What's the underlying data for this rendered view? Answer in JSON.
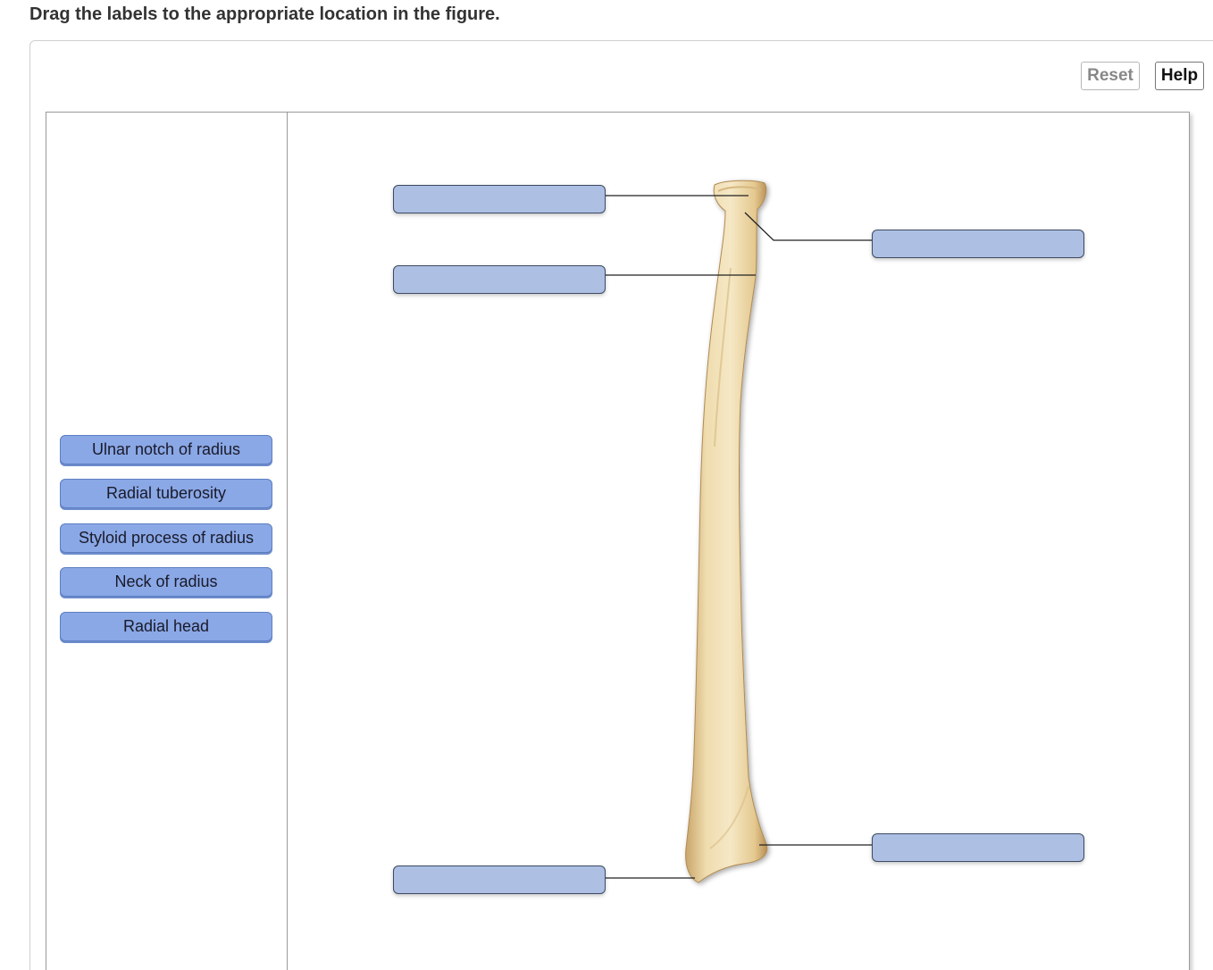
{
  "instruction": "Drag the labels to the appropriate location in the figure.",
  "toolbar": {
    "reset_label": "Reset",
    "help_label": "Help"
  },
  "label_bank": [
    {
      "label": "Ulnar notch of radius"
    },
    {
      "label": "Radial tuberosity"
    },
    {
      "label": "Styloid process of radius"
    },
    {
      "label": "Neck of radius"
    },
    {
      "label": "Radial head"
    }
  ],
  "colors": {
    "label_chip": "#8aa8e6",
    "drop_target": "#adc0e3",
    "bone": "#f1dfb4"
  },
  "figure": {
    "subject": "radius-bone",
    "drop_target_count": 5
  }
}
